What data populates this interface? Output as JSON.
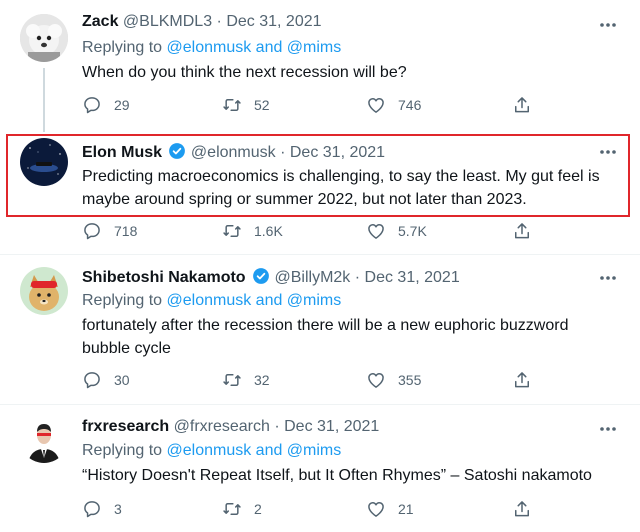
{
  "tweets": [
    {
      "name": "Zack",
      "handle": "@BLKMDL3",
      "date": "Dec 31, 2021",
      "separator": "·",
      "reply_prefix": "Replying to",
      "reply_mentions": "@elonmusk and @mims",
      "text": "When do you think the next recession will be?",
      "replies": "29",
      "retweets": "52",
      "likes": "746"
    },
    {
      "name": "Elon Musk",
      "handle": "@elonmusk",
      "date": "Dec 31, 2021",
      "separator": "·",
      "verified": true,
      "text_line1": "Predicting macroeconomics is challenging, to say the least. My gut feel is",
      "text_line2": "maybe around spring or summer 2022, but not later than 2023.",
      "replies": "718",
      "retweets": "1.6K",
      "likes": "5.7K"
    },
    {
      "name": "Shibetoshi Nakamoto",
      "handle": "@BillyM2k",
      "date": "Dec 31, 2021",
      "separator": "·",
      "verified": true,
      "reply_prefix": "Replying to",
      "reply_mentions": "@elonmusk and @mims",
      "text_line1": "fortunately after the recession there will be a new euphoric buzzword",
      "text_line2": "bubble cycle",
      "replies": "30",
      "retweets": "32",
      "likes": "355"
    },
    {
      "name": "frxresearch",
      "handle": "@frxresearch",
      "date": "Dec 31, 2021",
      "separator": "·",
      "reply_prefix": "Replying to",
      "reply_mentions": "@elonmusk and @mims",
      "text": "“History Doesn't Repeat Itself, but It Often Rhymes” – Satoshi nakamoto",
      "replies": "3",
      "retweets": "2",
      "likes": "21"
    }
  ],
  "colors": {
    "accent": "#1d9bf0",
    "muted": "#536471",
    "highlight_border": "#e0262b"
  },
  "icons": [
    "more-icon",
    "reply-icon",
    "retweet-icon",
    "like-icon",
    "share-icon",
    "verified-icon"
  ]
}
